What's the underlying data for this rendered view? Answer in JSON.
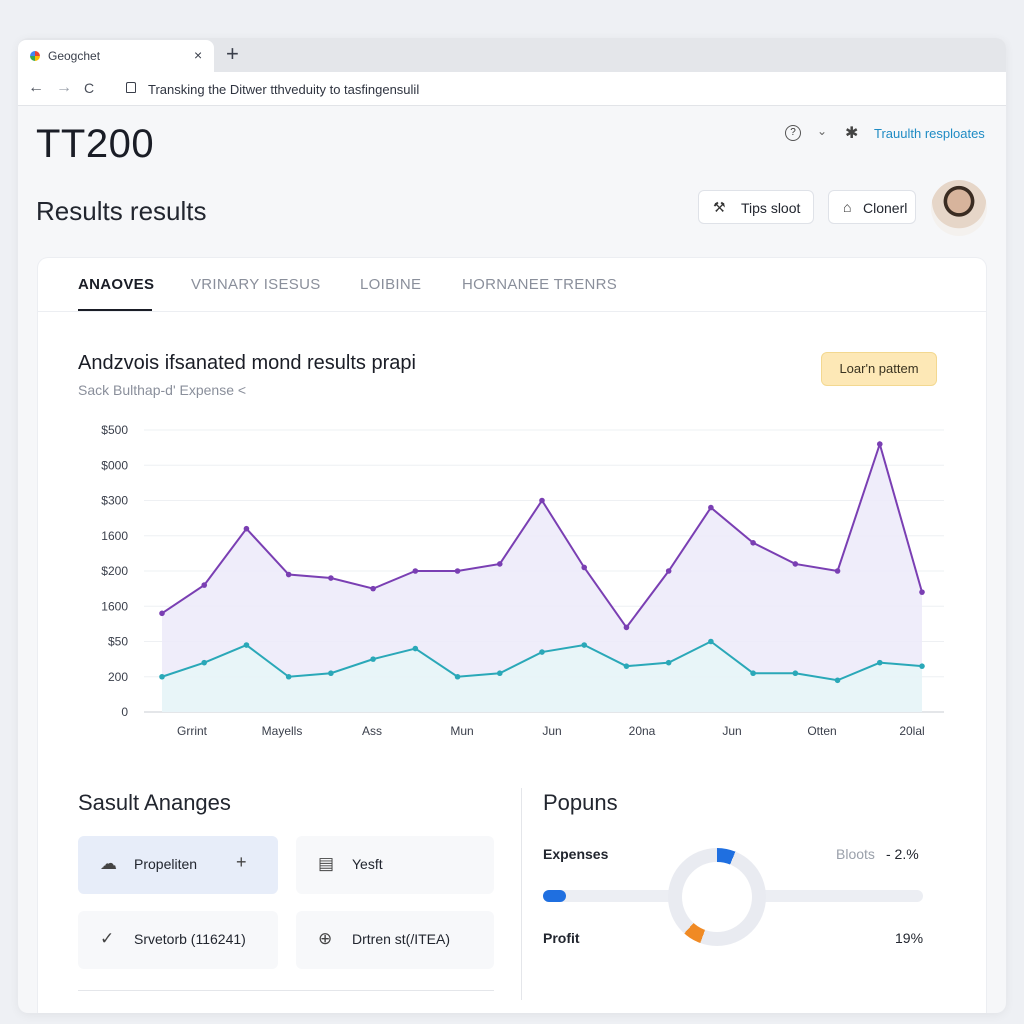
{
  "browser": {
    "tab_title": "Geogchet",
    "tab_close": "×",
    "new_tab": "+",
    "back": "←",
    "forward": "→",
    "reload": "C",
    "url": "Transking the Ditwer tthveduity to tasfingensulil"
  },
  "header": {
    "title": "TT200",
    "subtitle": "Results results",
    "help_icon": "?",
    "chevron": "⌄",
    "gear_icon": "✱",
    "link": "Trauulth resploates",
    "buttons": [
      {
        "icon": "⚒",
        "label": "Tips sloot"
      },
      {
        "icon": "⌂",
        "label": "Clonerl"
      }
    ]
  },
  "tabs": [
    {
      "label": "ANAOVES",
      "active": true
    },
    {
      "label": "VRINARY ISESUS",
      "active": false
    },
    {
      "label": "LOIBINE",
      "active": false
    },
    {
      "label": "HORNANEE TRENRS",
      "active": false
    }
  ],
  "chart_section": {
    "title": "Andzvois ifsanated mond results prapi",
    "subtitle": "Sack Bulthap-d' Expense <",
    "button": "Loar'n pattem"
  },
  "chart_data": {
    "type": "area",
    "y_tick_labels": [
      "0",
      "200",
      "$50",
      "1600",
      "$200",
      "1600",
      "$300",
      "$000",
      "$500"
    ],
    "x_tick_labels": [
      "Grrint",
      "Mayells",
      "Ass",
      "Mun",
      "Jun",
      "20na",
      "Jun",
      "Otten",
      "20lal"
    ],
    "ylim": [
      0,
      8
    ],
    "grid": true,
    "series": [
      {
        "color": "#7a3fb3",
        "fill": "#eceaf9",
        "points": [
          [
            0,
            2.8
          ],
          [
            1,
            3.6
          ],
          [
            2,
            5.2
          ],
          [
            3,
            3.9
          ],
          [
            4,
            3.8
          ],
          [
            5,
            3.5
          ],
          [
            6,
            4.0
          ],
          [
            7,
            4.0
          ],
          [
            8,
            4.2
          ],
          [
            9,
            6.0
          ],
          [
            10,
            4.1
          ],
          [
            11,
            2.4
          ],
          [
            12,
            4.0
          ],
          [
            13,
            5.8
          ],
          [
            14,
            4.8
          ],
          [
            15,
            4.2
          ],
          [
            16,
            4.0
          ],
          [
            17,
            7.6
          ],
          [
            18,
            3.4
          ]
        ]
      },
      {
        "color": "#2aa8b8",
        "fill": "#e6f6f7",
        "points": [
          [
            0,
            1.0
          ],
          [
            1,
            1.4
          ],
          [
            2,
            1.9
          ],
          [
            3,
            1.0
          ],
          [
            4,
            1.1
          ],
          [
            5,
            1.5
          ],
          [
            6,
            1.8
          ],
          [
            7,
            1.0
          ],
          [
            8,
            1.1
          ],
          [
            9,
            1.7
          ],
          [
            10,
            1.9
          ],
          [
            11,
            1.3
          ],
          [
            12,
            1.4
          ],
          [
            13,
            2.0
          ],
          [
            14,
            1.1
          ],
          [
            15,
            1.1
          ],
          [
            16,
            0.9
          ],
          [
            17,
            1.4
          ],
          [
            18,
            1.3
          ]
        ]
      }
    ]
  },
  "section_left": {
    "title": "Sasult Ananges",
    "tiles": [
      {
        "icon": "☁",
        "label": "Propeliten",
        "plus": "+"
      },
      {
        "icon": "▤",
        "label": "Yesft"
      },
      {
        "icon": "✓",
        "label": "Srvetorb  (116241)"
      },
      {
        "icon": "⊕",
        "label": "Drtren st(/ITEA)"
      }
    ]
  },
  "section_right": {
    "title": "Popuns",
    "expenses_label": "Expenses",
    "boots_label": "Bloots",
    "boots_value": "- 2.%",
    "profit_label": "Profit",
    "profit_value": "19%",
    "progress_fraction": 0.06,
    "donut_colors": {
      "blue": "#1f6fe0",
      "orange": "#f08a24",
      "track": "#e9ebf1"
    }
  }
}
